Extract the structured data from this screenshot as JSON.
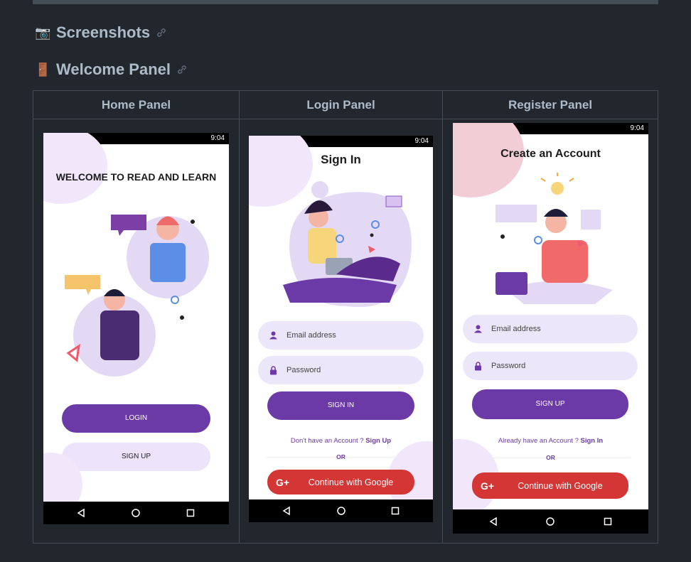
{
  "sections": {
    "screenshots": {
      "emoji": "📷",
      "title": "Screenshots"
    },
    "welcome": {
      "emoji": "🚪",
      "title": "Welcome Panel"
    }
  },
  "table": {
    "headers": [
      "Home Panel",
      "Login Panel",
      "Register Panel"
    ]
  },
  "status": {
    "time": "9:04"
  },
  "home": {
    "title": "WELCOME TO READ AND LEARN",
    "login": "LOGIN",
    "signup": "SIGN UP"
  },
  "login": {
    "title": "Sign In",
    "email_placeholder": "Email address",
    "password_placeholder": "Password",
    "signin": "SIGN IN",
    "footer_text": "Don't have an Account ? ",
    "footer_link": "Sign Up",
    "or": "OR",
    "google": "Continue with Google"
  },
  "register": {
    "title": "Create an Account",
    "email_placeholder": "Email address",
    "password_placeholder": "Password",
    "signup": "SIGN UP",
    "footer_text": "Already have an Account ? ",
    "footer_link": "Sign In",
    "or": "OR",
    "google": "Continue with Google"
  },
  "colors": {
    "accent": "#6c3aa6",
    "field": "#ece6fb",
    "google": "#d43535",
    "bg": "#22272e"
  }
}
